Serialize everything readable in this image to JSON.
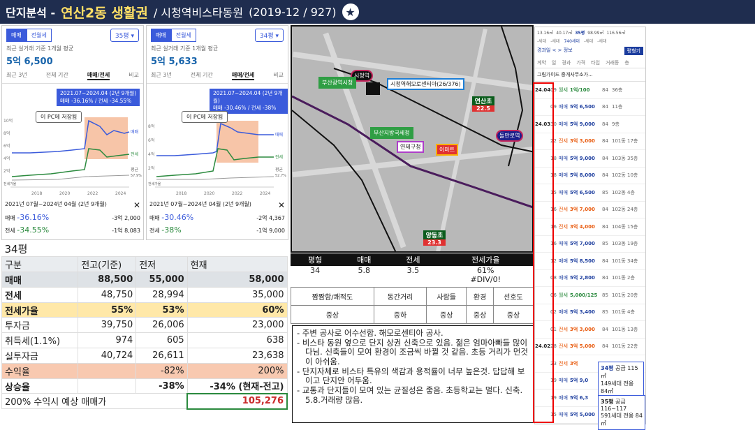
{
  "header": {
    "prefix": "단지분석 -",
    "area": "연산2동 생활권",
    "complex": "/ 시청역비스타동원",
    "meta": "(2019-12 / 927)",
    "star": "★"
  },
  "panel1": {
    "tab_sale": "매매",
    "tab_rent": "전월세",
    "size": "35평 ▾",
    "sub": "최근 실거래 기준 1개월 평균",
    "price": "5억 6,500",
    "tabs": [
      "최근 3년",
      "전체 기간",
      "매매/전세",
      "비교"
    ],
    "tip_line1": "2021.07~2024.04 (2년 9개월)",
    "tip_line2": "매매 -36.16% / 전세 -34.55%",
    "save": "이 PC에 저장됨",
    "yticks": [
      "10억",
      "8억",
      "6억",
      "4억",
      "2억",
      "0억"
    ],
    "xticks": [
      "2018",
      "2020",
      "2022",
      "2024"
    ],
    "legend_sale": "매매",
    "legend_rent": "전세",
    "legend_avg": "평균",
    "avg_pct": "57.9%",
    "baseline": "전세가율",
    "range": "2021년 07월~2024년 04월 (2년 9개월)",
    "close": "✕",
    "sale_label": "매매",
    "sale_pct": "-36.16%",
    "sale_amt": "-3억 2,000",
    "rent_label": "전세",
    "rent_pct": "-34.55%",
    "rent_amt": "-1억 8,083"
  },
  "panel2": {
    "tab_sale": "매매",
    "tab_rent": "전월세",
    "size": "34평 ▾",
    "sub": "최근 실거래 기준 1개월 평균",
    "price": "5억 5,633",
    "tabs": [
      "최근 3년",
      "전체 기간",
      "매매/전세",
      "비교"
    ],
    "tip_line1": "2021.07~2024.04 (2년 9개월)",
    "tip_line2": "매매 -30.46% / 전세 -38%",
    "save": "이 PC에 저장됨",
    "yticks": [
      "8억",
      "6억",
      "4억",
      "2억",
      "0억"
    ],
    "xticks": [
      "2018",
      "2020",
      "2022",
      "2024"
    ],
    "legend_sale": "매매",
    "legend_rent": "전세",
    "legend_avg": "평균",
    "avg_pct": "52.7%",
    "baseline": "전세가율",
    "range": "2021년 07월~2024년 04월 (2년 9개월)",
    "close": "✕",
    "sale_label": "매매",
    "sale_pct": "-30.46%",
    "sale_amt": "-2억 4,367",
    "rent_label": "전세",
    "rent_pct": "-38%",
    "rent_amt": "-1억 9,000"
  },
  "map": {
    "station": "시청역",
    "complex_label": "시청역해모로센티아(26/376)",
    "busan_hall": "부산광역시청",
    "tax": "부산지방국세청",
    "ward": "연제구청",
    "emart": "이마트",
    "yeonsan_ele": "연산초",
    "yeonsan_ele_val": "22.5",
    "yangjeong_ele": "양동초",
    "yangjeong_ele_val": "23.3",
    "dolmaru": "돌만로역"
  },
  "stats": {
    "headers": [
      "평형",
      "매매",
      "전세",
      "전세가율"
    ],
    "values": [
      "34",
      "5.8",
      "3.5",
      "61%"
    ],
    "extra": "#DIV/0!"
  },
  "eval": {
    "headers": [
      "짬짬함/쾌적도",
      "동간거리",
      "사람들",
      "환경",
      "선호도"
    ],
    "values": [
      "중상",
      "중하",
      "중상",
      "중상",
      "중상"
    ]
  },
  "notes": [
    "- 주변 공사로 어수선함. 해모로센티아 공사.",
    "- 비스타 동원 옆으로 단지 상권 신축으로 있음. 젊은 엄마아빠들 많이 다님. 신축들이 모여 환경이 조금씩 바뀔 것 같음. 초등 거리가 먼것이 아쉬움.",
    "- 단지자체로 비스타 특유의 색감과 용적률이 너무 높은것. 답답해 보이고 단지안 어두움.",
    "- 교통과 단지들이 모여 있는 균질성은 좋음. 초등학교는 멀다. 신축. 5.8.거래량 많음."
  ],
  "table": {
    "title": "34평",
    "headers": [
      "구분",
      "전고(기준)",
      "전저",
      "현재"
    ],
    "rows": [
      [
        "매매",
        "88,500",
        "55,000",
        "58,000"
      ],
      [
        "전세",
        "48,750",
        "28,994",
        "35,000"
      ],
      [
        "전세가율",
        "55%",
        "53%",
        "60%"
      ],
      [
        "투자금",
        "39,750",
        "26,006",
        "23,000"
      ],
      [
        "취득세(1.1%)",
        "974",
        "605",
        "638"
      ],
      [
        "실투자금",
        "40,724",
        "26,611",
        "23,638"
      ],
      [
        "수익율",
        "",
        "-82%",
        "200%"
      ],
      [
        "상승율",
        "",
        "-38%",
        "-34%"
      ]
    ],
    "rise_note": "(현재-전고)",
    "forecast_label": "200% 수익시 예상 매매가",
    "forecast_value": "105,276"
  },
  "listing": {
    "summary": [
      "13.16㎡",
      "40.17㎡",
      "35평",
      "98.99㎡",
      "116.56㎡"
    ],
    "summary2": [
      "-세대",
      "-세대",
      "740세대",
      "-세대",
      "-세대"
    ],
    "btn": "평형기",
    "filter": "경과일 < > 정보",
    "cols": [
      "계약",
      "일",
      "경과",
      "가격",
      "타입",
      "거래동",
      "층"
    ],
    "agent": "그림가이드 중개사무소가...",
    "rows": [
      {
        "date": "24.04",
        "d": "09",
        "k": "월세",
        "p": "1억/100",
        "t": "84",
        "f": "36층"
      },
      {
        "date": "",
        "d": "09",
        "k": "매매",
        "p": "5억 6,500",
        "t": "84",
        "f": "11층"
      },
      {
        "date": "24.03",
        "d": "30",
        "k": "매매",
        "p": "5억 9,000",
        "t": "84",
        "f": "9층"
      },
      {
        "date": "",
        "d": "22",
        "k": "전세",
        "p": "3억 3,000",
        "t": "84",
        "f": "101동 17층"
      },
      {
        "date": "",
        "d": "18",
        "k": "매매",
        "p": "5억 9,000",
        "t": "84",
        "f": "103동 35층"
      },
      {
        "date": "",
        "d": "18",
        "k": "매매",
        "p": "5억 8,000",
        "t": "84",
        "f": "102동 10층"
      },
      {
        "date": "",
        "d": "15",
        "k": "매매",
        "p": "5억 6,500",
        "t": "85",
        "f": "102동 4층"
      },
      {
        "date": "",
        "d": "16",
        "k": "전세",
        "p": "3억 7,000",
        "t": "84",
        "f": "102동 24층"
      },
      {
        "date": "",
        "d": "16",
        "k": "전세",
        "p": "3억 4,000",
        "t": "84",
        "f": "104동 15층"
      },
      {
        "date": "",
        "d": "16",
        "k": "매매",
        "p": "5억 7,000",
        "t": "85",
        "f": "103동 19층"
      },
      {
        "date": "",
        "d": "12",
        "k": "매매",
        "p": "5억 8,500",
        "t": "84",
        "f": "101동 34층"
      },
      {
        "date": "",
        "d": "08",
        "k": "매매",
        "p": "5억 2,800",
        "t": "84",
        "f": "101동 2층"
      },
      {
        "date": "",
        "d": "06",
        "k": "월세",
        "p": "5,000/125",
        "t": "85",
        "f": "101동 20층"
      },
      {
        "date": "",
        "d": "02",
        "k": "매매",
        "p": "5억 3,400",
        "t": "85",
        "f": "101동 4층"
      },
      {
        "date": "",
        "d": "01",
        "k": "전세",
        "p": "3억 3,000",
        "t": "84",
        "f": "101동 13층"
      },
      {
        "date": "24.02",
        "d": "28",
        "k": "전세",
        "p": "3억 5,000",
        "t": "84",
        "f": "101동 22층"
      },
      {
        "date": "",
        "d": "23",
        "k": "전세",
        "p": "3억",
        "t": "",
        "f": ""
      },
      {
        "date": "",
        "d": "19",
        "k": "매매",
        "p": "5억 9,0",
        "t": "",
        "f": ""
      },
      {
        "date": "",
        "d": "19",
        "k": "매매",
        "p": "5억 6,3",
        "t": "",
        "f": ""
      },
      {
        "date": "",
        "d": "15",
        "k": "매매",
        "p": "5억 5,000",
        "t": "",
        "f": ""
      }
    ],
    "pop1_size": "34평",
    "pop1_supply": "공급 115㎡",
    "pop1_units": "149세대",
    "pop1_excl": "전용 84㎡",
    "pop2_size": "35평",
    "pop2_supply": "공급 116~117",
    "pop2_units": "591세대",
    "pop2_excl": "전용 84㎡"
  },
  "colors": {
    "navy": "#1f2d4f",
    "accent": "#3b5bdb",
    "sale": "#3b5bdb",
    "rent": "#2b8a3e"
  }
}
